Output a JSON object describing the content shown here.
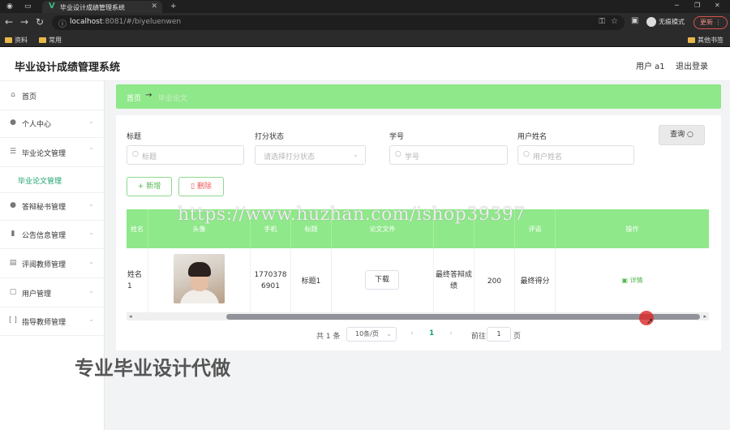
{
  "browser": {
    "tab_title": "毕业设计成绩管理系统",
    "url_host": "localhost",
    "url_path": ":8081/#/biyeluenwen",
    "profile_label": "无痕模式",
    "update_label": "更新",
    "bookmarks": [
      "资料",
      "常用"
    ],
    "other_bookmarks": "其他书签"
  },
  "header": {
    "app_title": "毕业设计成绩管理系统",
    "user": "用户 a1",
    "logout": "退出登录"
  },
  "sidebar": {
    "items": [
      {
        "label": "首页",
        "icon": "home-icon"
      },
      {
        "label": "个人中心",
        "icon": "user-icon"
      },
      {
        "label": "毕业论文管理",
        "icon": "list-icon"
      },
      {
        "label": "毕业论文管理",
        "icon": ""
      },
      {
        "label": "答辩秘书管理",
        "icon": "user-icon"
      },
      {
        "label": "公告信息管理",
        "icon": "chart-icon"
      },
      {
        "label": "评阅教师管理",
        "icon": "doc-icon"
      },
      {
        "label": "用户管理",
        "icon": "window-icon"
      },
      {
        "label": "指导教师管理",
        "icon": "bracket-icon"
      }
    ]
  },
  "breadcrumb": {
    "home": "首页",
    "current": "毕业论文"
  },
  "filters": {
    "title": {
      "label": "标题",
      "placeholder": "标题"
    },
    "status": {
      "label": "打分状态",
      "placeholder": "请选择打分状态"
    },
    "student_no": {
      "label": "学号",
      "placeholder": "学号"
    },
    "user_name": {
      "label": "用户姓名",
      "placeholder": "用户姓名"
    },
    "query": "查询"
  },
  "actions": {
    "add": "新增",
    "delete": "删除"
  },
  "table": {
    "headers": [
      "姓名",
      "头像",
      "手机",
      "标题",
      "论文文件",
      "",
      "",
      "评语",
      "操作"
    ],
    "row": {
      "name": "姓名1",
      "phone": "17703786901",
      "title": "标题1",
      "download": "下载",
      "result": "最终答辩成绩",
      "score": "200",
      "comment": "最终得分",
      "detail": "详情"
    }
  },
  "pagination": {
    "total": "共 1 条",
    "page_size": "10条/页",
    "current": "1",
    "goto": "前往",
    "goto_value": "1",
    "unit": "页"
  },
  "overlay": {
    "watermark_url": "https://www.huzhan.com/ishop39397",
    "promo": "专业毕业设计代做"
  },
  "colors": {
    "accent": "#8fe88a",
    "brand_green": "#1aa36b"
  }
}
